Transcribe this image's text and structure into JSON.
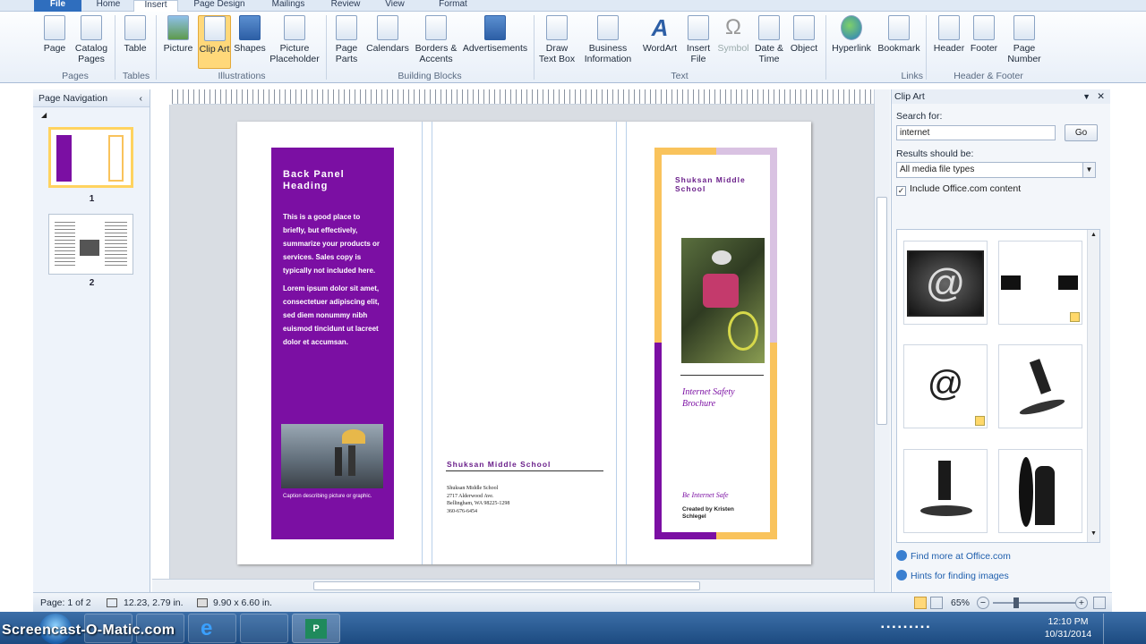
{
  "tabs": {
    "file": "File",
    "home": "Home",
    "insert": "Insert",
    "page_design": "Page Design",
    "mailings": "Mailings",
    "review": "Review",
    "view": "View",
    "format": "Format"
  },
  "ribbon": {
    "buttons": {
      "page": "Page",
      "catalog_pages": "Catalog Pages",
      "table": "Table",
      "picture": "Picture",
      "clip_art": "Clip Art",
      "shapes": "Shapes",
      "picture_placeholder": "Picture Placeholder",
      "page_parts": "Page Parts",
      "calendars": "Calendars",
      "borders_accents": "Borders & Accents",
      "advertisements": "Advertisements",
      "draw_text_box": "Draw Text Box",
      "business_information": "Business Information",
      "wordart": "WordArt",
      "insert_file": "Insert File",
      "symbol": "Symbol",
      "date_time": "Date & Time",
      "object": "Object",
      "hyperlink": "Hyperlink",
      "bookmark": "Bookmark",
      "header": "Header",
      "footer": "Footer",
      "page_number": "Page Number"
    },
    "groups": {
      "pages": "Pages",
      "tables": "Tables",
      "illustrations": "Illustrations",
      "building_blocks": "Building Blocks",
      "text": "Text",
      "links": "Links",
      "header_footer": "Header & Footer"
    }
  },
  "nav": {
    "title": "Page Navigation",
    "pages": [
      "1",
      "2"
    ]
  },
  "brochure": {
    "back_heading": "Back Panel Heading",
    "back_para1": "This is a good place to briefly, but effectively, summarize your products or services. Sales copy is typically not included here.",
    "back_para2": "Lorem ipsum dolor sit amet, consectetuer adipiscing elit, sed diem nonummy nibh euismod tincidunt ut lacreet dolor et accumsan.",
    "caption": "Caption describing picture or graphic.",
    "mid_school": "Shuksan Middle School",
    "mid_address": [
      "Shuksan Middle School",
      "2717 Alderwood Ave.",
      "Bellingham, WA 98225-1298",
      "360-676-6454"
    ],
    "front_school": "Shuksan Middle School",
    "front_title": "Internet Safety Brochure",
    "front_safe": "Be Internet Safe",
    "front_created": "Created by Kristen Schlegel"
  },
  "clipart": {
    "title": "Clip Art",
    "search_label": "Search for:",
    "search_value": "internet",
    "go": "Go",
    "results_label": "Results should be:",
    "media_type": "All media file types",
    "include": "Include Office.com content",
    "find_more": "Find more at Office.com",
    "hints": "Hints for finding images"
  },
  "status": {
    "page": "Page: 1 of 2",
    "position": "12.23, 2.79 in.",
    "size": "9.90 x 6.60 in.",
    "zoom": "65%"
  },
  "taskbar": {
    "watermark": "Screencast-O-Matic.com",
    "time": "12:10 PM",
    "date": "10/31/2014"
  },
  "colors": {
    "purple": "#7b0fa3",
    "yellow": "#f9c35c",
    "lilac": "#d9c2e2",
    "accent_blue": "#2f6ebe"
  }
}
